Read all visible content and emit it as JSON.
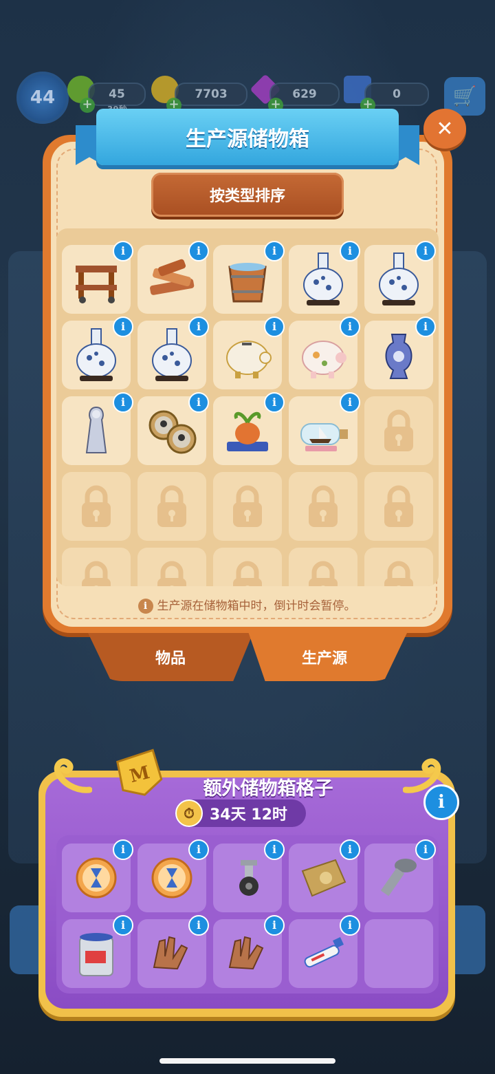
{
  "hud": {
    "level": "44",
    "energy": "45",
    "energy_timer": "39秒",
    "coins": "7703",
    "gems": "629",
    "stars": "0"
  },
  "storage": {
    "title": "生产源储物箱",
    "sort_label": "按类型排序",
    "note": "生产源在储物箱中时，倒计时会暂停。",
    "slots": [
      {
        "icon": "wooden-cart-icon",
        "info": "i"
      },
      {
        "icon": "firewood-icon",
        "info": "i"
      },
      {
        "icon": "wooden-bucket-icon",
        "info": "i"
      },
      {
        "icon": "porcelain-vase-icon",
        "info": "i"
      },
      {
        "icon": "porcelain-vase-icon",
        "info": "i"
      },
      {
        "icon": "porcelain-vase-icon",
        "info": "i"
      },
      {
        "icon": "porcelain-vase-icon",
        "info": "i"
      },
      {
        "icon": "gold-piggy-bank-icon",
        "info": "i"
      },
      {
        "icon": "floral-piggy-bank-icon",
        "info": "i"
      },
      {
        "icon": "blue-urn-icon",
        "info": "i"
      },
      {
        "icon": "statuette-icon",
        "info": "i"
      },
      {
        "icon": "photo-locket-icon",
        "info": "i"
      },
      {
        "icon": "potted-bulb-icon",
        "info": "i"
      },
      {
        "icon": "ship-in-bottle-icon",
        "info": "i"
      },
      {
        "icon": "lock-icon"
      }
    ],
    "locked_rows": 2
  },
  "tabs": {
    "items": "物品",
    "producers": "生产源"
  },
  "extra": {
    "title": "额外储物箱格子",
    "badge_letter": "M",
    "timer": "34天 12时",
    "info": "i",
    "slots": [
      {
        "icon": "hourglass-orb-icon"
      },
      {
        "icon": "hourglass-orb-icon"
      },
      {
        "icon": "caster-wheel-icon"
      },
      {
        "icon": "sandbag-icon"
      },
      {
        "icon": "screw-icon"
      },
      {
        "icon": "paint-can-icon"
      },
      {
        "icon": "leather-gloves-icon"
      },
      {
        "icon": "leather-gloves-icon"
      },
      {
        "icon": "tube-icon"
      },
      {
        "icon": "empty-slot"
      }
    ]
  },
  "colors": {
    "panel_orange": "#e07a2e",
    "panel_cream": "#f6dfb7",
    "title_blue": "#33a6de",
    "purple": "#8a4cc4",
    "info_blue": "#1d8fe0"
  }
}
